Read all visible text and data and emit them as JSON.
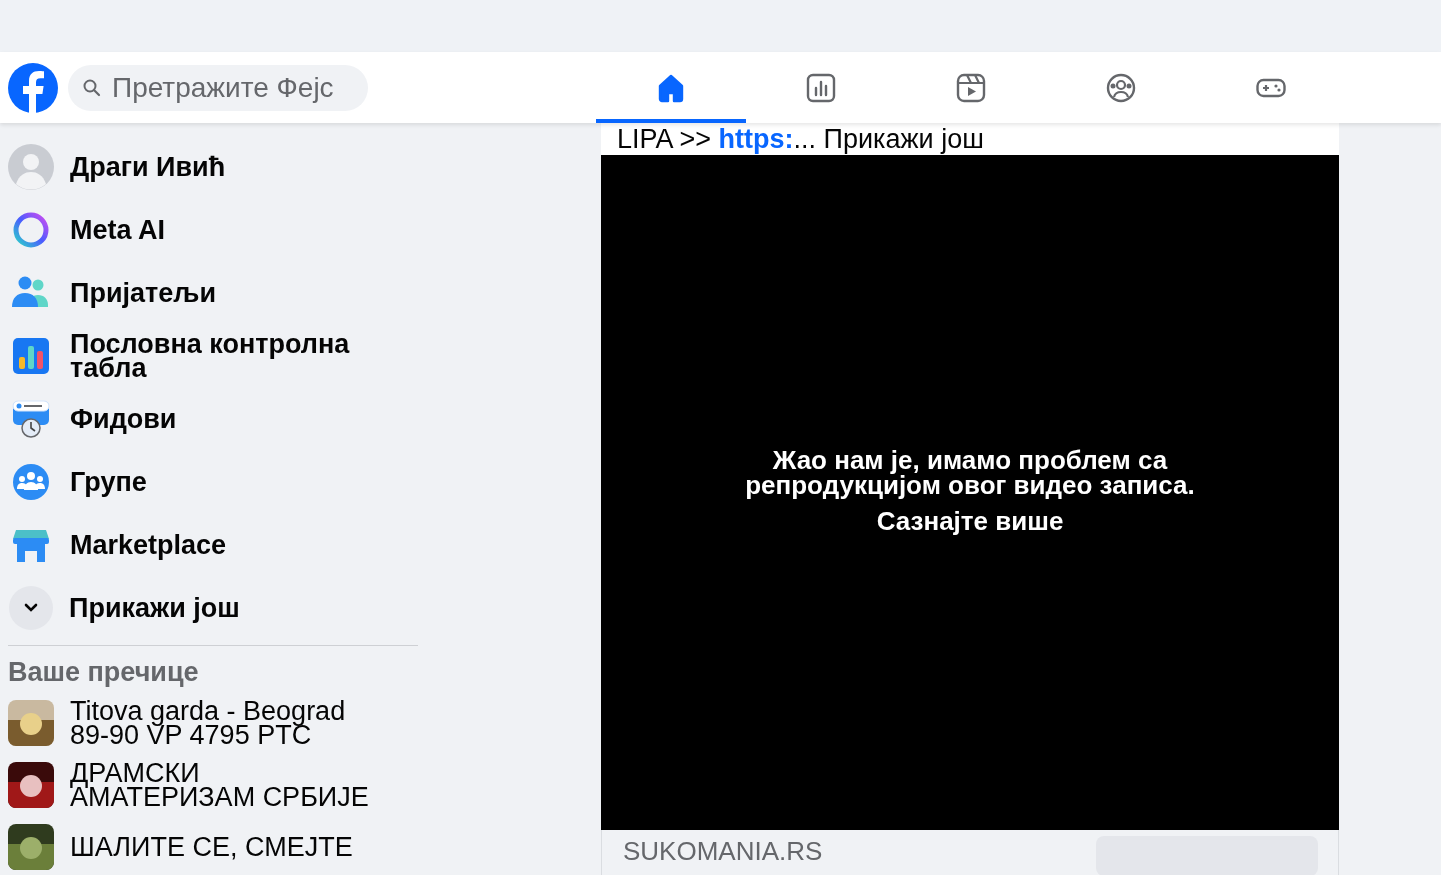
{
  "header": {
    "search": {
      "placeholder": "Претражите Фејс"
    },
    "tabs": [
      {
        "kind": "home",
        "selected": true
      },
      {
        "kind": "dashboard",
        "selected": false
      },
      {
        "kind": "video",
        "selected": false
      },
      {
        "kind": "groups",
        "selected": false
      },
      {
        "kind": "gaming",
        "selected": false
      }
    ]
  },
  "sidebar": {
    "items": [
      {
        "kind": "avatar",
        "label": "Драги Ивић"
      },
      {
        "kind": "meta-ai",
        "label": "Meta AI"
      },
      {
        "kind": "friends",
        "label": "Пријатељи"
      },
      {
        "kind": "dashboard",
        "label": "Пословна контролна табла"
      },
      {
        "kind": "feeds",
        "label": "Фидови"
      },
      {
        "kind": "groups",
        "label": "Групе"
      },
      {
        "kind": "marketplace",
        "label": "Marketplace"
      },
      {
        "kind": "more",
        "label": "Прикажи још"
      }
    ],
    "shortcuts_title": "Ваше пречице",
    "shortcuts": [
      {
        "label": "Titova garda - Beograd 89-90 VP 4795 PTC",
        "kind": "picture"
      },
      {
        "label": "ДРАМСКИ АМАТЕРИЗАМ СРБИЈЕ",
        "kind": "picture"
      },
      {
        "label": "ШАЛИТЕ СЕ, СМЕЈТЕ",
        "kind": "picture"
      }
    ]
  },
  "post": {
    "text_before": "LIPA >> ",
    "link": "https:",
    "text_after": "... Прикажи још",
    "video": {
      "message": "Жао нам је, имамо проблем са репродукцијом овог видео записа.",
      "link": "Сазнајте више"
    },
    "footer": {
      "source": "SUKOMANIA.RS"
    }
  }
}
